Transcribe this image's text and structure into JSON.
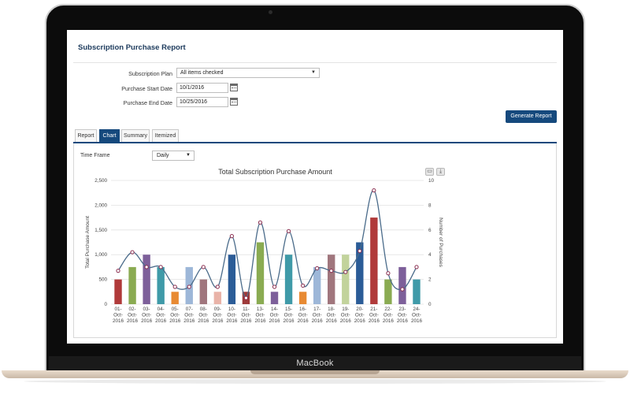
{
  "device": {
    "brand": "MacBook"
  },
  "report": {
    "title": "Subscription Purchase Report"
  },
  "form": {
    "plan_label": "Subscription Plan",
    "plan_value": "All items checked",
    "start_label": "Purchase Start Date",
    "start_value": "10/1/2016",
    "end_label": "Purchase End Date",
    "end_value": "10/25/2016",
    "generate_button": "Generate Report"
  },
  "tabs": [
    {
      "label": "Report",
      "active": false
    },
    {
      "label": "Chart",
      "active": true
    },
    {
      "label": "Summary",
      "active": false
    },
    {
      "label": "Itemized",
      "active": false
    }
  ],
  "timeframe": {
    "label": "Time Frame",
    "value": "Daily"
  },
  "chart_toolbar": {
    "print_icon": "printer-icon",
    "download_icon": "download-icon"
  },
  "colors": {
    "brand": "#15497d",
    "line": "#4a6b8a",
    "marker_fill": "#ffffff",
    "marker_stroke": "#8a2d4f"
  },
  "chart_data": {
    "type": "bar",
    "title": "Total Subscription Purchase Amount",
    "ylabel": "Total Purchase Amount",
    "y2label": "Number of Purchases",
    "ylim": [
      0,
      2500
    ],
    "y2lim": [
      0,
      10
    ],
    "yticks": [
      "0",
      "500",
      "1,000",
      "1,500",
      "2,000",
      "2,500"
    ],
    "y2ticks": [
      "0",
      "2",
      "4",
      "6",
      "8",
      "10"
    ],
    "categories": [
      [
        "01-",
        "Oct-",
        "2016"
      ],
      [
        "02-",
        "Oct-",
        "2016"
      ],
      [
        "03-",
        "Oct-",
        "2016"
      ],
      [
        "04-",
        "Oct-",
        "2016"
      ],
      [
        "05-",
        "Oct-",
        "2016"
      ],
      [
        "07-",
        "Oct-",
        "2016"
      ],
      [
        "08-",
        "Oct-",
        "2016"
      ],
      [
        "09-",
        "Oct-",
        "2016"
      ],
      [
        "10-",
        "Oct-",
        "2016"
      ],
      [
        "11-",
        "Oct-",
        "2016"
      ],
      [
        "13-",
        "Oct-",
        "2016"
      ],
      [
        "14-",
        "Oct-",
        "2016"
      ],
      [
        "15-",
        "Oct-",
        "2016"
      ],
      [
        "16-",
        "Oct-",
        "2016"
      ],
      [
        "17-",
        "Oct-",
        "2016"
      ],
      [
        "18-",
        "Oct-",
        "2016"
      ],
      [
        "19-",
        "Oct-",
        "2016"
      ],
      [
        "20-",
        "Oct-",
        "2016"
      ],
      [
        "21-",
        "Oct-",
        "2016"
      ],
      [
        "22-",
        "Oct-",
        "2016"
      ],
      [
        "23-",
        "Oct-",
        "2016"
      ],
      [
        "24-",
        "Oct-",
        "2016"
      ]
    ],
    "bar_values": [
      500,
      750,
      1000,
      750,
      250,
      750,
      500,
      250,
      1000,
      250,
      1250,
      250,
      1000,
      250,
      750,
      1000,
      1000,
      1250,
      1750,
      500,
      750,
      500
    ],
    "bar_colors": [
      "#b03a3a",
      "#8aab52",
      "#7d5f9a",
      "#3f9aa8",
      "#e88a33",
      "#9db7d8",
      "#a0767d",
      "#e9b3a8",
      "#2b5c97",
      "#9e3a3a",
      "#8aab52",
      "#7d5f9a",
      "#3f9aa8",
      "#e88a33",
      "#9db7d8",
      "#a0767d",
      "#c2d39c",
      "#2b5c97",
      "#b03a3a",
      "#8aab52",
      "#7d5f9a",
      "#3f9aa8"
    ],
    "line_values": [
      2.7,
      4.2,
      3.0,
      3.0,
      1.4,
      1.4,
      3.0,
      1.4,
      5.5,
      0.5,
      6.6,
      1.4,
      5.9,
      1.5,
      2.9,
      2.7,
      2.6,
      4.3,
      9.2,
      2.5,
      1.2,
      3.0
    ]
  }
}
